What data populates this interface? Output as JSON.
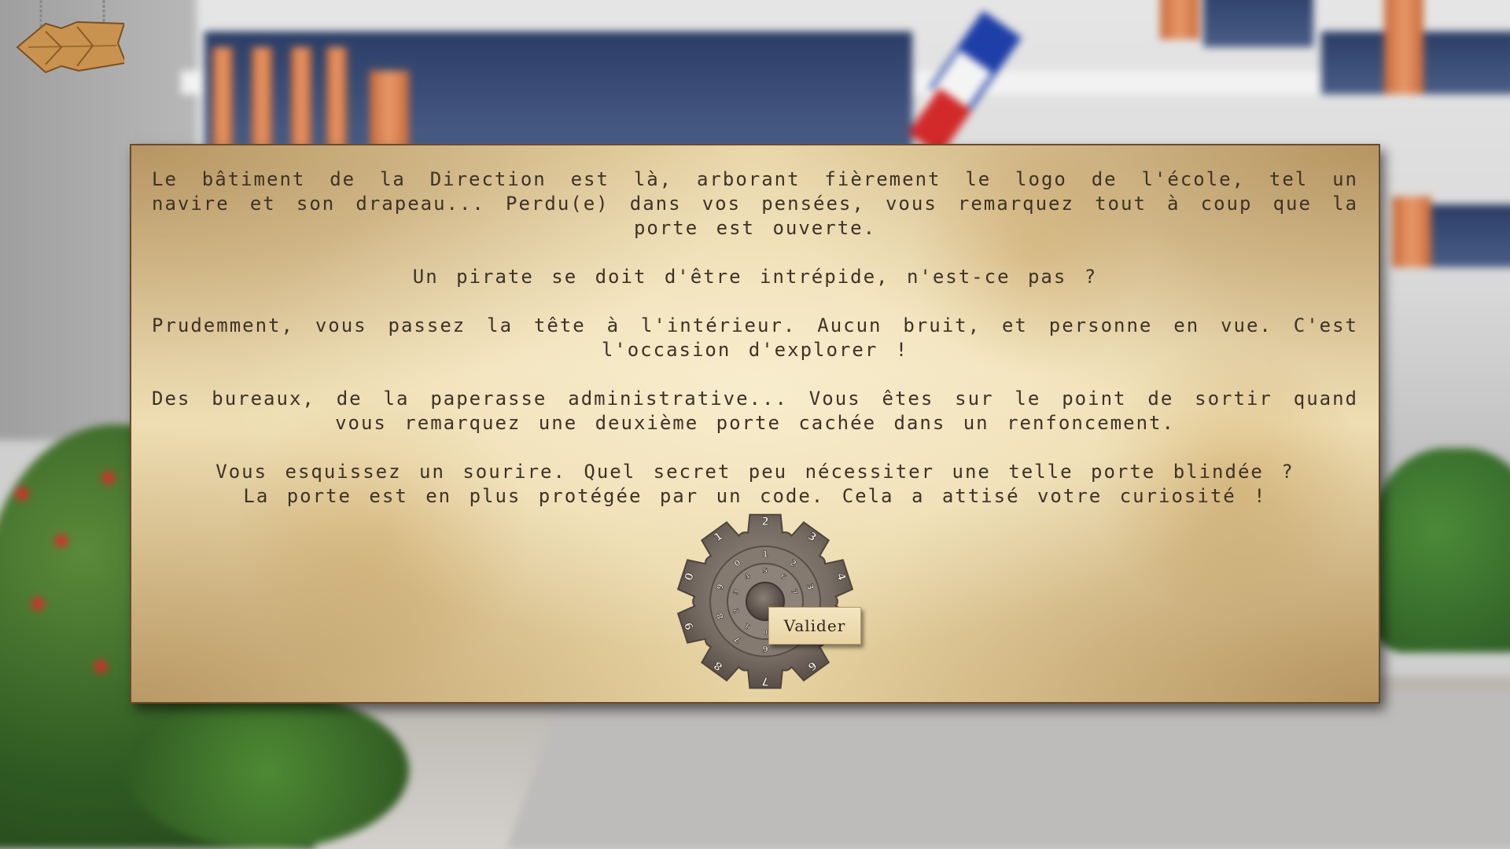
{
  "navigation": {
    "back_icon": "wooden-arrow-sign-icon"
  },
  "story": {
    "paragraphs": [
      "Le bâtiment de la Direction est là, arborant fièrement le logo de l'école, tel un navire et son drapeau... Perdu(e) dans vos pensées, vous remarquez tout à coup que la porte est ouverte.",
      "Un pirate se doit d'être intrépide, n'est-ce pas ?",
      "Prudemment, vous passez la tête à l'intérieur. Aucun bruit, et personne en vue. C'est l'occasion d'explorer !",
      "Des bureaux, de la paperasse administrative... Vous êtes sur le point de sortir quand vous remarquez une deuxième porte cachée dans un renfoncement.",
      "Vous esquissez un sourire. Quel secret peu nécessiter une telle porte blindée ?",
      "La porte est en plus protégée par un code. Cela a attisé votre curiosité !"
    ]
  },
  "code_lock": {
    "icon": "gear-code-wheel-icon",
    "outer_digits": [
      "2",
      "3",
      "4",
      "5",
      "6",
      "7",
      "8",
      "9",
      "0",
      "1"
    ],
    "middle_digits": [
      "1",
      "2",
      "3",
      "4",
      "5",
      "6",
      "7",
      "8",
      "9",
      "0"
    ],
    "inner_digits": [
      "5",
      "6",
      "7",
      "8",
      "9",
      "0",
      "1",
      "2",
      "3",
      "4"
    ],
    "validate_label": "Valider"
  },
  "colors": {
    "parchment": "#ecdcb0",
    "text": "#3e3226",
    "gear": "#7a6f66",
    "button": "#efdfb5"
  }
}
